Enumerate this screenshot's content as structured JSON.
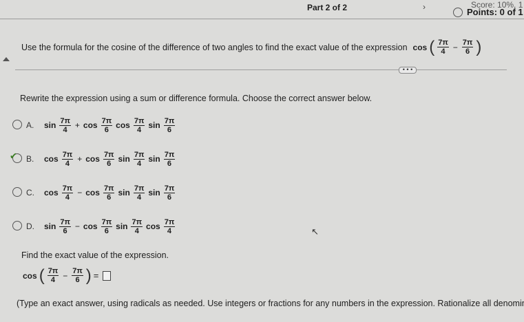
{
  "header": {
    "score_text": "Score: 10%, 1",
    "part_label": "Part 2 of 2",
    "chevron": "›",
    "points_label": "Points: 0 of 1"
  },
  "question": {
    "text": "Use the formula for the cosine of the difference of two angles to find the exact value of the expression",
    "expr_fn": "cos",
    "frac1_num": "7π",
    "frac1_den": "4",
    "frac2_num": "7π",
    "frac2_den": "6",
    "minus": "−"
  },
  "more_button": "• • •",
  "instruction": "Rewrite the expression using a sum or difference formula. Choose the correct answer below.",
  "options": [
    {
      "letter": "A.",
      "terms": [
        [
          "sin",
          "7π",
          "4"
        ],
        [
          "cos",
          "7π",
          "6"
        ],
        [
          "cos",
          "7π",
          "4"
        ],
        [
          "sin",
          "7π",
          "6"
        ]
      ],
      "ops": [
        "",
        "+",
        "",
        ""
      ]
    },
    {
      "letter": "B.",
      "terms": [
        [
          "cos",
          "7π",
          "4"
        ],
        [
          "cos",
          "7π",
          "6"
        ],
        [
          "sin",
          "7π",
          "4"
        ],
        [
          "sin",
          "7π",
          "6"
        ]
      ],
      "ops": [
        "",
        "+",
        "",
        ""
      ]
    },
    {
      "letter": "C.",
      "terms": [
        [
          "cos",
          "7π",
          "4"
        ],
        [
          "cos",
          "7π",
          "6"
        ],
        [
          "sin",
          "7π",
          "4"
        ],
        [
          "sin",
          "7π",
          "6"
        ]
      ],
      "ops": [
        "",
        "−",
        "",
        ""
      ]
    },
    {
      "letter": "D.",
      "terms": [
        [
          "sin",
          "7π",
          "6"
        ],
        [
          "cos",
          "7π",
          "6"
        ],
        [
          "sin",
          "7π",
          "4"
        ],
        [
          "cos",
          "7π",
          "4"
        ]
      ],
      "ops": [
        "",
        "−",
        "",
        ""
      ]
    }
  ],
  "selected_option": "B.",
  "find_text": "Find the exact value of the expression.",
  "answer": {
    "fn": "cos",
    "frac1_num": "7π",
    "frac1_den": "4",
    "frac2_num": "7π",
    "frac2_den": "6",
    "minus": "−",
    "equals": "="
  },
  "type_note": "(Type an exact answer, using radicals as needed. Use integers or fractions for any numbers in the expression. Rationalize all denomina",
  "check_mark": "✔",
  "cursor_glyph": "↖"
}
